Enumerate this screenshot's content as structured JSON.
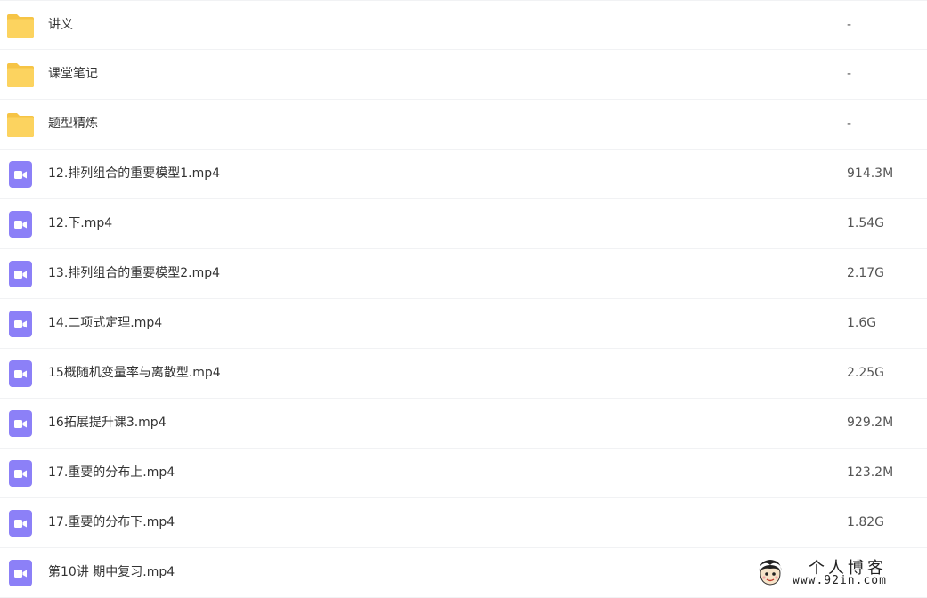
{
  "files": [
    {
      "name": "讲义",
      "size": "-",
      "icon": "folder-icon"
    },
    {
      "name": "课堂笔记",
      "size": "-",
      "icon": "folder-icon"
    },
    {
      "name": "题型精炼",
      "size": "-",
      "icon": "folder-icon"
    },
    {
      "name": "12.排列组合的重要模型1.mp4",
      "size": "914.3M",
      "icon": "video-icon"
    },
    {
      "name": "12.下.mp4",
      "size": "1.54G",
      "icon": "video-icon"
    },
    {
      "name": "13.排列组合的重要模型2.mp4",
      "size": "2.17G",
      "icon": "video-icon"
    },
    {
      "name": "14.二项式定理.mp4",
      "size": "1.6G",
      "icon": "video-icon"
    },
    {
      "name": "15概随机变量率与离散型.mp4",
      "size": "2.25G",
      "icon": "video-icon"
    },
    {
      "name": "16拓展提升课3.mp4",
      "size": "929.2M",
      "icon": "video-icon"
    },
    {
      "name": "17.重要的分布上.mp4",
      "size": "123.2M",
      "icon": "video-icon"
    },
    {
      "name": "17.重要的分布下.mp4",
      "size": "1.82G",
      "icon": "video-icon"
    },
    {
      "name": "第10讲 期中复习.mp4",
      "size": "",
      "icon": "video-icon"
    }
  ],
  "watermark": {
    "title": "个人博客",
    "url": "www.92in.com"
  },
  "colors": {
    "folder": "#fcd35f",
    "folder_tab": "#f6c445",
    "video": "#8c80f7",
    "row_divider": "#f1f2f4"
  }
}
